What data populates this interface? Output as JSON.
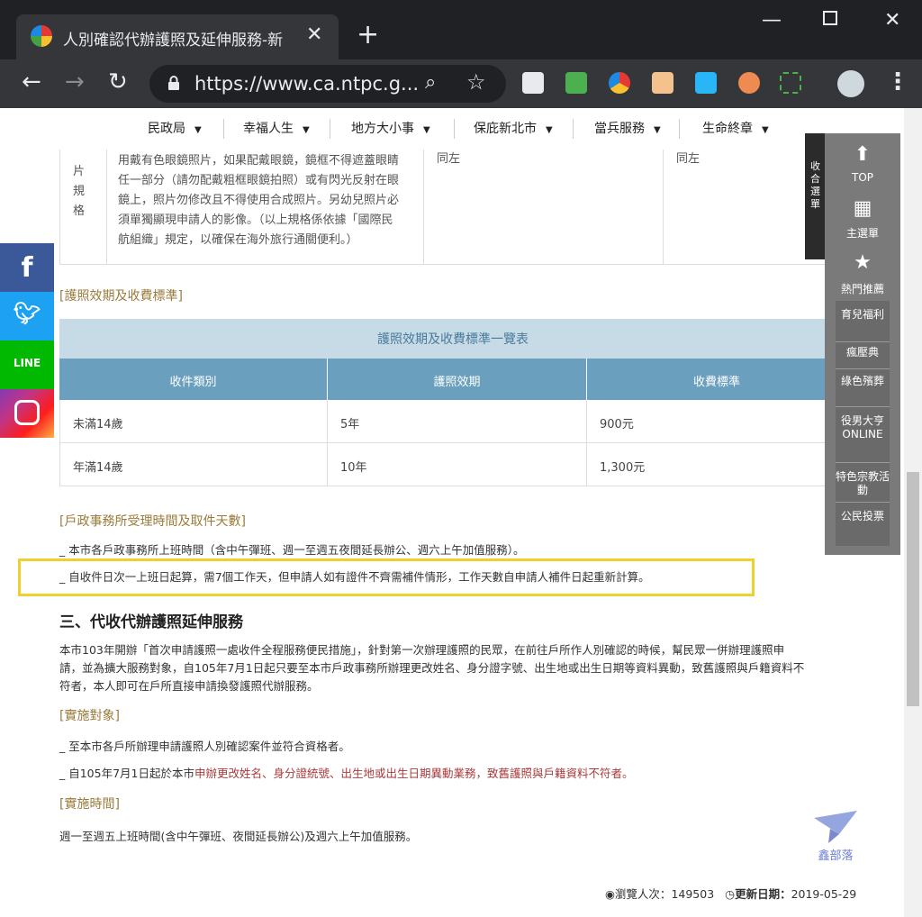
{
  "browser": {
    "tab_title": "人別確認代辦護照及延伸服務-新",
    "url": "https://www.ca.ntpc.g..."
  },
  "nav": {
    "items": [
      "民政局",
      "幸福人生",
      "地方大小事",
      "保庇新北市",
      "當兵服務",
      "生命終章"
    ]
  },
  "spec": {
    "col1": [
      "片",
      "規",
      "格"
    ],
    "col2": [
      "用戴有色眼鏡照片，如果配戴眼鏡，鏡框不得遮蓋眼睛",
      "任一部分（請勿配戴粗框眼鏡拍照）或有閃光反射在眼",
      "鏡上，照片勿修改且不得使用合成照片。另幼兒照片必",
      "須單獨顯現申請人的影像。（以上規格係依據「國際民",
      "航組織」規定，以確保在海外旅行通關便利。）"
    ],
    "col3": "同左",
    "col4": "同左"
  },
  "section_passport": "[護照效期及收費標準]",
  "fee_table": {
    "caption": "護照效期及收費標準一覽表",
    "headers": [
      "收件類別",
      "護照效期",
      "收費標準"
    ],
    "rows": [
      [
        "未滿14歲",
        "5年",
        "900元"
      ],
      [
        "年滿14歲",
        "10年",
        "1,300元"
      ]
    ]
  },
  "section_hours": "[戶政事務所受理時間及取件天數]",
  "hours_lines": [
    "_ 本市各戶政事務所上班時間（含中午彈班、週一至週五夜間延長辦公、週六上午加值服務）。",
    "_ 自收件日次一上班日起算，需7個工作天，但申請人如有證件不齊需補件情形，工作天數自申請人補件日起重新計算。"
  ],
  "heading3": "三、代收代辦護照延伸服務",
  "paragraph": [
    "本市103年開辦「首次申請護照一處收件全程服務便民措施」，針對第一次辦理護照的民眾，在前往戶所作人別確認的時候，幫民眾一併辦理護照申",
    "請，並為擴大服務對象，自105年7月1日起只要至本市戶政事務所辦理更改姓名、身分證字號、出生地或出生日期等資料異動，致舊護照與戶籍資料不",
    "符者，本人即可在戶所直接申請換發護照代辦服務。"
  ],
  "section_target": "[實施對象]",
  "target_lines": {
    "line1": "_ 至本市各戶所辦理申請護照人別確認案件並符合資格者。",
    "line2_prefix": "_ 自105年7月1日起於本市",
    "line2_red": "申辦更改姓名、身分證統號、出生地或出生日期異動業務，致舊護照與戶籍資料不符者。"
  },
  "section_time": "[實施時間]",
  "time_line": "週一至週五上班時間(含中午彈班、夜間延長辦公)及週六上午加值服務。",
  "footer": {
    "views_label": "瀏覽人次：",
    "views": "149503",
    "updated_label": "更新日期：",
    "updated": "2019-05-29"
  },
  "float_menu": {
    "collapse": "收合選單",
    "top": "TOP",
    "main": "主選單",
    "hot": "熱門推薦",
    "sub": [
      "育兒福利",
      "瘋壓典",
      "綠色殯葬",
      "役男大亨ONLINE",
      "特色宗教活動",
      "公民投票"
    ]
  },
  "watermark": "鑫部落",
  "colors": {
    "facebook": "#3b5998",
    "twitter": "#1da1f2",
    "line": "#00b900",
    "instagram": "#c13584",
    "highlight": "#f0d030"
  }
}
